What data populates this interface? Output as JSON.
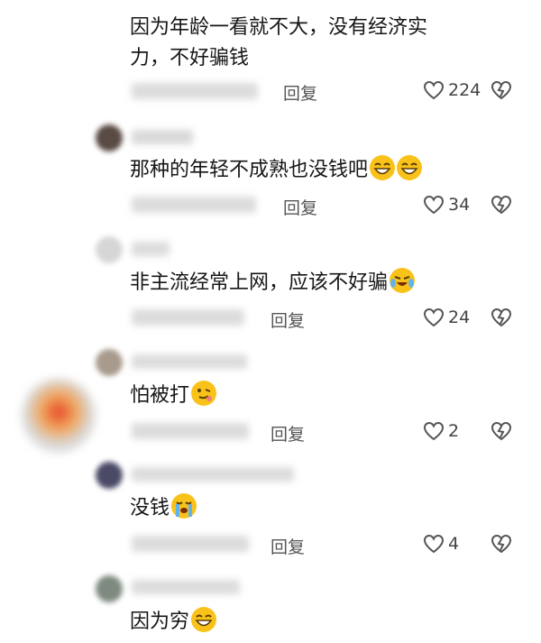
{
  "comments": [
    {
      "text_line1": "因为年龄一看就不大，没有经济实",
      "text_line2": "力，不好骗钱",
      "reply": "回复",
      "likes": "224"
    },
    {
      "text": "那种的年轻不成熟也没钱吧",
      "emojis": [
        "grin-icon",
        "grin-icon"
      ],
      "reply": "回复",
      "likes": "34"
    },
    {
      "text": "非主流经常上网，应该不好骗",
      "emojis": [
        "crying-laugh-icon"
      ],
      "reply": "回复",
      "likes": "24"
    },
    {
      "text": "怕被打",
      "emojis": [
        "drooling-face-icon"
      ],
      "reply": "回复",
      "likes": "2"
    },
    {
      "text": "没钱",
      "emojis": [
        "loudly-crying-icon"
      ],
      "reply": "回复",
      "likes": "4"
    },
    {
      "text": "因为穷",
      "emojis": [
        "grin-icon"
      ]
    }
  ],
  "colors": {
    "emoji_yellow": "#f9c21b",
    "text": "#161616",
    "meta": "#555555"
  }
}
